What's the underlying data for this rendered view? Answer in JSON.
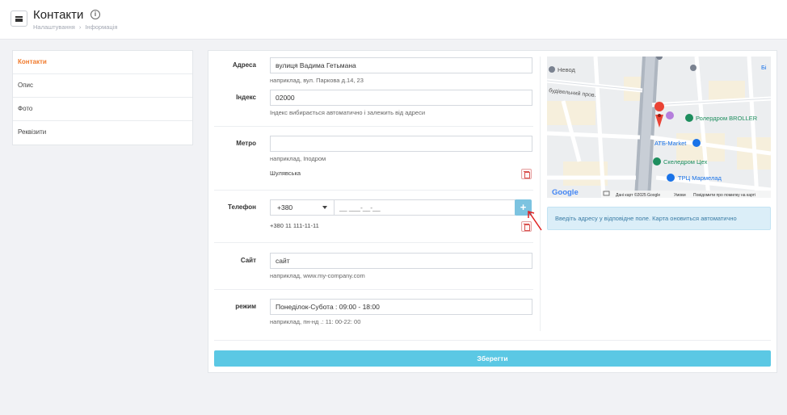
{
  "header": {
    "title": "Контакти",
    "breadcrumb": [
      "Налаштування",
      "Інформація"
    ]
  },
  "sidebar": {
    "items": [
      {
        "label": "Контакти",
        "active": true
      },
      {
        "label": "Опис",
        "active": false
      },
      {
        "label": "Фото",
        "active": false
      },
      {
        "label": "Реквізити",
        "active": false
      }
    ]
  },
  "form": {
    "address": {
      "label": "Адреса",
      "value": "вулиця Вадима Гетьмана",
      "hint": "наприклад, вул. Паркова д.14, 23"
    },
    "index": {
      "label": "Індекс",
      "value": "02000",
      "hint": "Індекс вибирається автоматично і залежить від адреси"
    },
    "metro": {
      "label": "Метро",
      "value": "",
      "hint": "наприклад, Іподром",
      "saved": "Шулявська"
    },
    "phone": {
      "label": "Телефон",
      "country_code": "+380",
      "placeholder": "__ ___-__-__",
      "saved": "+380 11 111-11-11",
      "add_label": "+"
    },
    "site": {
      "label": "Сайт",
      "value": "сайт",
      "hint": "наприклад, www.my-company.com"
    },
    "schedule": {
      "label": "режим",
      "value": "Понеділок-Субота : 09:00 - 18:00",
      "hint": "наприклад, пн-нд .: 11: 00-22: 00"
    }
  },
  "map": {
    "labels": {
      "nevod": "Невод",
      "budivelnyi": "будівельний пров.",
      "rolerdrom": "Ролердром BROLLER",
      "atb": "АТБ-Market",
      "skeledrom": "Скеледром Цех",
      "marmelad": "ТРЦ Мармелад",
      "bu": "Бі"
    },
    "google": "Google",
    "footer": [
      "Дані карт ©2025 Google",
      "Умови",
      "Повідомити про помилку на карті"
    ],
    "note": "Введіть адресу у відповідне поле. Карта оновиться автоматично"
  },
  "actions": {
    "save_label": "Зберегти"
  },
  "colors": {
    "accent": "#f07a2c",
    "save": "#5bc8e4",
    "info_bg": "#dbeef8",
    "danger": "#d9534f"
  }
}
